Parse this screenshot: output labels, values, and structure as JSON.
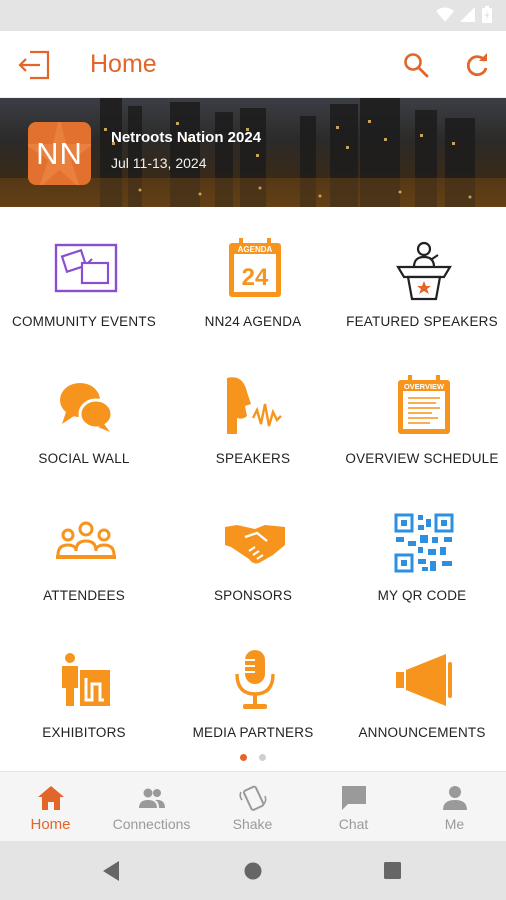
{
  "header": {
    "title": "Home",
    "exit_icon": "exit-icon",
    "search_icon": "search-icon",
    "refresh_icon": "refresh-icon"
  },
  "banner": {
    "logo_text": "NN",
    "event_name": "Netroots Nation 2024",
    "event_date": "Jul 11-13, 2024"
  },
  "calendar_badge": {
    "header": "AGENDA",
    "day": "24"
  },
  "overview_badge": {
    "header": "OVERVIEW"
  },
  "tiles": [
    {
      "label": "COMMUNITY EVENTS",
      "icon": "community-events-icon"
    },
    {
      "label": "NN24 AGENDA",
      "icon": "calendar-icon"
    },
    {
      "label": "FEATURED SPEAKERS",
      "icon": "podium-icon"
    },
    {
      "label": "SOCIAL WALL",
      "icon": "chat-bubbles-icon"
    },
    {
      "label": "SPEAKERS",
      "icon": "speaking-head-icon"
    },
    {
      "label": "OVERVIEW SCHEDULE",
      "icon": "schedule-icon"
    },
    {
      "label": "ATTENDEES",
      "icon": "group-icon"
    },
    {
      "label": "SPONSORS",
      "icon": "handshake-icon"
    },
    {
      "label": "MY QR CODE",
      "icon": "qr-code-icon"
    },
    {
      "label": "EXHIBITORS",
      "icon": "exhibitor-booth-icon"
    },
    {
      "label": "MEDIA PARTNERS",
      "icon": "microphone-icon"
    },
    {
      "label": "ANNOUNCEMENTS",
      "icon": "megaphone-icon"
    }
  ],
  "pagination": {
    "pages": 2,
    "current": 1
  },
  "bottom_nav": [
    {
      "label": "Home",
      "icon": "home-icon",
      "active": true
    },
    {
      "label": "Connections",
      "icon": "people-icon",
      "active": false
    },
    {
      "label": "Shake",
      "icon": "shake-phone-icon",
      "active": false
    },
    {
      "label": "Chat",
      "icon": "chat-icon",
      "active": false
    },
    {
      "label": "Me",
      "icon": "person-icon",
      "active": false
    }
  ],
  "colors": {
    "accent": "#e2652a",
    "icon_orange": "#f7941d",
    "icon_purple": "#8a4fd0",
    "icon_blue": "#2d8fe0",
    "inactive": "#9a9a9a"
  }
}
